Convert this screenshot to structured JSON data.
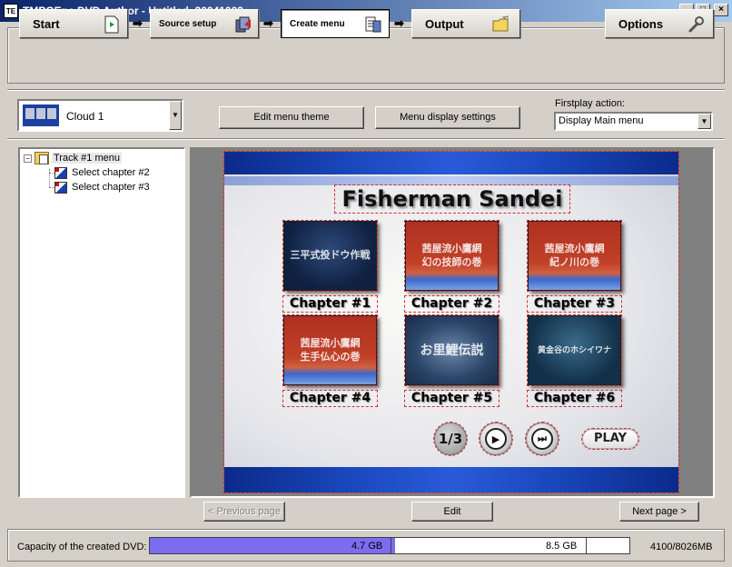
{
  "window": {
    "app_icon_text": "TE",
    "title": "TMPGEnc DVD Author - Untitled_20041003",
    "minimize": "_",
    "maximize": "□",
    "close": "×"
  },
  "steps": {
    "start": "Start",
    "source_setup": "Source setup",
    "create_menu": "Create menu",
    "output": "Output",
    "options": "Options",
    "arrow": "➡"
  },
  "theme": {
    "name": "Cloud 1"
  },
  "buttons": {
    "edit_menu_theme": "Edit menu theme",
    "menu_display_settings": "Menu display settings",
    "previous_page": "< Previous page",
    "edit": "Edit",
    "next_page": "Next page >"
  },
  "firstplay": {
    "label": "Firstplay action:",
    "value": "Display Main menu"
  },
  "tree": {
    "root_expander": "−",
    "root": "Track #1 menu",
    "items": [
      "Select chapter #2",
      "Select chapter #3"
    ]
  },
  "menu": {
    "title": "Fisherman Sandei",
    "chapters": [
      {
        "label": "Chapter #1",
        "thumb_text": "三平式投ドウ作戦"
      },
      {
        "label": "Chapter #2",
        "thumb_text": "茜屋流小鷹網\n幻の技師の巻"
      },
      {
        "label": "Chapter #3",
        "thumb_text": "茜屋流小鷹網\n紀ノ川の巻"
      },
      {
        "label": "Chapter #4",
        "thumb_text": "茜屋流小鷹網\n生手仏心の巻"
      },
      {
        "label": "Chapter #5",
        "thumb_text": "お里鯉伝説"
      },
      {
        "label": "Chapter #6",
        "thumb_text": "黄金谷のホシイワナ"
      }
    ],
    "page_indicator": "1/3",
    "play_icon": "▶",
    "skip_icon": "⏭",
    "play_label": "PLAY"
  },
  "capacity": {
    "label": "Capacity of the created DVD:",
    "mark_1": "4.7 GB",
    "mark_2": "8.5 GB",
    "total": "4100/8026MB",
    "used_mb": 4100,
    "max_mb": 8026,
    "fill_color": "#7b6cf0"
  }
}
